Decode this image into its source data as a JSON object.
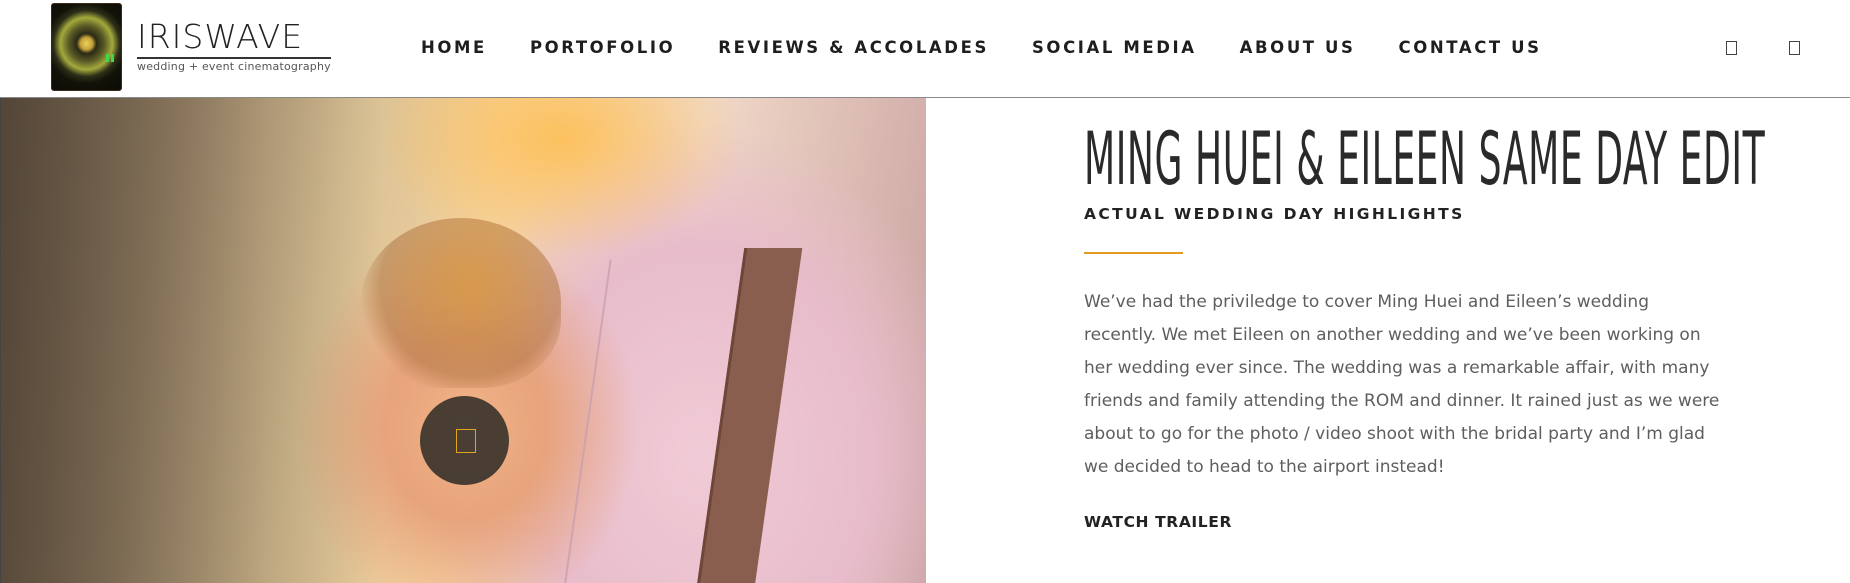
{
  "brand": {
    "name": "IRISWAVE",
    "tagline": "wedding + event cinematography",
    "logo_icon": "camera-lens-icon"
  },
  "nav": {
    "items": [
      {
        "label": "HOME"
      },
      {
        "label": "PORTOFOLIO"
      },
      {
        "label": "REVIEWS & ACCOLADES"
      },
      {
        "label": "SOCIAL MEDIA"
      },
      {
        "label": "ABOUT US"
      },
      {
        "label": "CONTACT US"
      }
    ],
    "icons": [
      "social-icon",
      "search-icon"
    ]
  },
  "hero": {
    "play_icon": "play-icon"
  },
  "content": {
    "title": "MING HUEI & EILEEN SAME DAY EDIT",
    "subtitle": "ACTUAL WEDDING DAY HIGHLIGHTS",
    "description": "We’ve had the priviledge to cover Ming Huei and Eileen’s wedding recently. We met Eileen on another wedding and we’ve been working on her wedding ever since. The wedding was a remarkable affair, with many friends and family attending the ROM and dinner. It rained just as we were about to go for the photo / video shoot with the bridal party and I’m glad we decided to head to the airport instead!",
    "cta": "WATCH TRAILER"
  },
  "colors": {
    "accent": "#e29c24",
    "text_dark": "#222222",
    "text_body": "#5e5e5e",
    "play_overlay": "#2d2a26"
  }
}
